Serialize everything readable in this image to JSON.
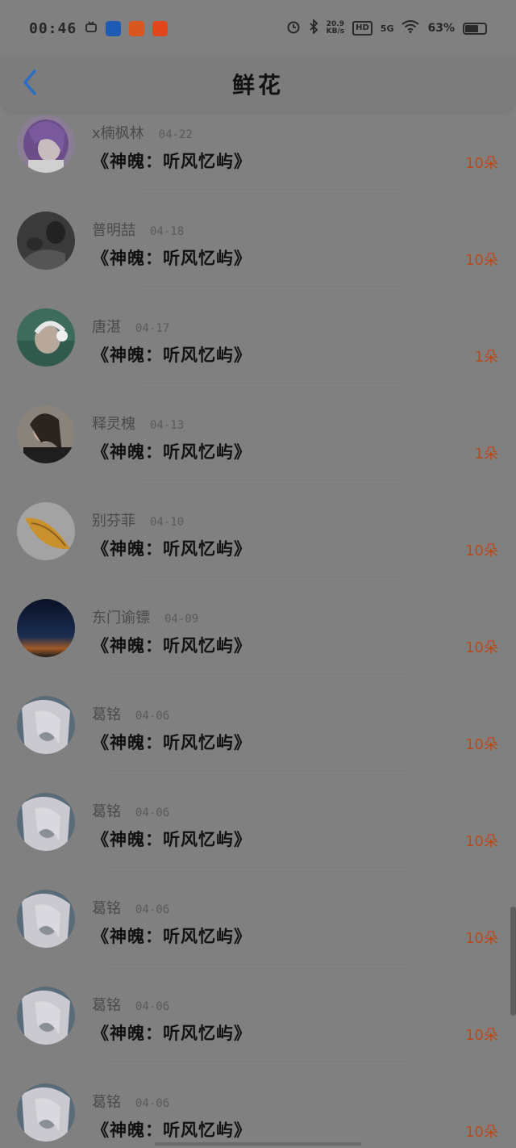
{
  "status_bar": {
    "time": "00:46",
    "network_speed": "20.9\nKB/s",
    "hd": "HD",
    "cellular": "5G",
    "battery": "63%",
    "battery_level": 0.63
  },
  "header": {
    "title": "鲜花",
    "back_icon": "chevron-left-icon",
    "back_color": "#2b6cc4"
  },
  "colors": {
    "count": "#b84a1c",
    "background": "#808080"
  },
  "items": [
    {
      "name": "x楠枫林",
      "date": "04-22",
      "book": "《神魄：听风忆屿》",
      "count": "10朵",
      "avatar": "anime-purple-hair"
    },
    {
      "name": "普明喆",
      "date": "04-18",
      "book": "《神魄：听风忆屿》",
      "count": "10朵",
      "avatar": "dark-photo"
    },
    {
      "name": "唐湛",
      "date": "04-17",
      "book": "《神魄：听风忆屿》",
      "count": "1朵",
      "avatar": "headphones-girl"
    },
    {
      "name": "释灵槐",
      "date": "04-13",
      "book": "《神魄：听风忆屿》",
      "count": "1朵",
      "avatar": "woman-photo"
    },
    {
      "name": "别芬菲",
      "date": "04-10",
      "book": "《神魄：听风忆屿》",
      "count": "10朵",
      "avatar": "seashell"
    },
    {
      "name": "东门谕镖",
      "date": "04-09",
      "book": "《神魄：听风忆屿》",
      "count": "10朵",
      "avatar": "night-sky"
    },
    {
      "name": "葛铭",
      "date": "04-06",
      "book": "《神魄：听风忆屿》",
      "count": "10朵",
      "avatar": "white-hair-anime"
    },
    {
      "name": "葛铭",
      "date": "04-06",
      "book": "《神魄：听风忆屿》",
      "count": "10朵",
      "avatar": "white-hair-anime"
    },
    {
      "name": "葛铭",
      "date": "04-06",
      "book": "《神魄：听风忆屿》",
      "count": "10朵",
      "avatar": "white-hair-anime"
    },
    {
      "name": "葛铭",
      "date": "04-06",
      "book": "《神魄：听风忆屿》",
      "count": "10朵",
      "avatar": "white-hair-anime"
    },
    {
      "name": "葛铭",
      "date": "04-06",
      "book": "《神魄：听风忆屿》",
      "count": "10朵",
      "avatar": "white-hair-anime"
    }
  ]
}
